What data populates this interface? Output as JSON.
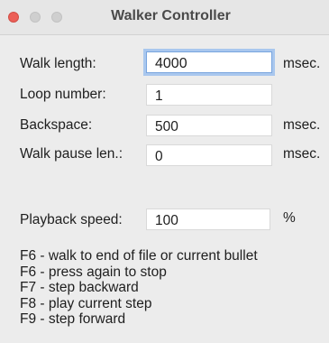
{
  "window": {
    "title": "Walker Controller"
  },
  "fields": [
    {
      "label": "Walk length:",
      "value": "4000",
      "unit": "msec."
    },
    {
      "label": "Loop number:",
      "value": "1",
      "unit": ""
    },
    {
      "label": "Backspace:",
      "value": "500",
      "unit": "msec."
    },
    {
      "label": "Walk pause len.:",
      "value": "0",
      "unit": "msec."
    }
  ],
  "playback": {
    "label": "Playback speed:",
    "value": "100",
    "unit": "%"
  },
  "help": [
    "F6 - walk to end of file or current bullet",
    "F6 - press again to stop",
    "F7 - step backward",
    "F8 - play current step",
    "F9 - step forward"
  ],
  "colors": {
    "close": "#ec5f57",
    "inactive_light": "#cfcfcf",
    "focus_ring": "#a9c7ee"
  }
}
